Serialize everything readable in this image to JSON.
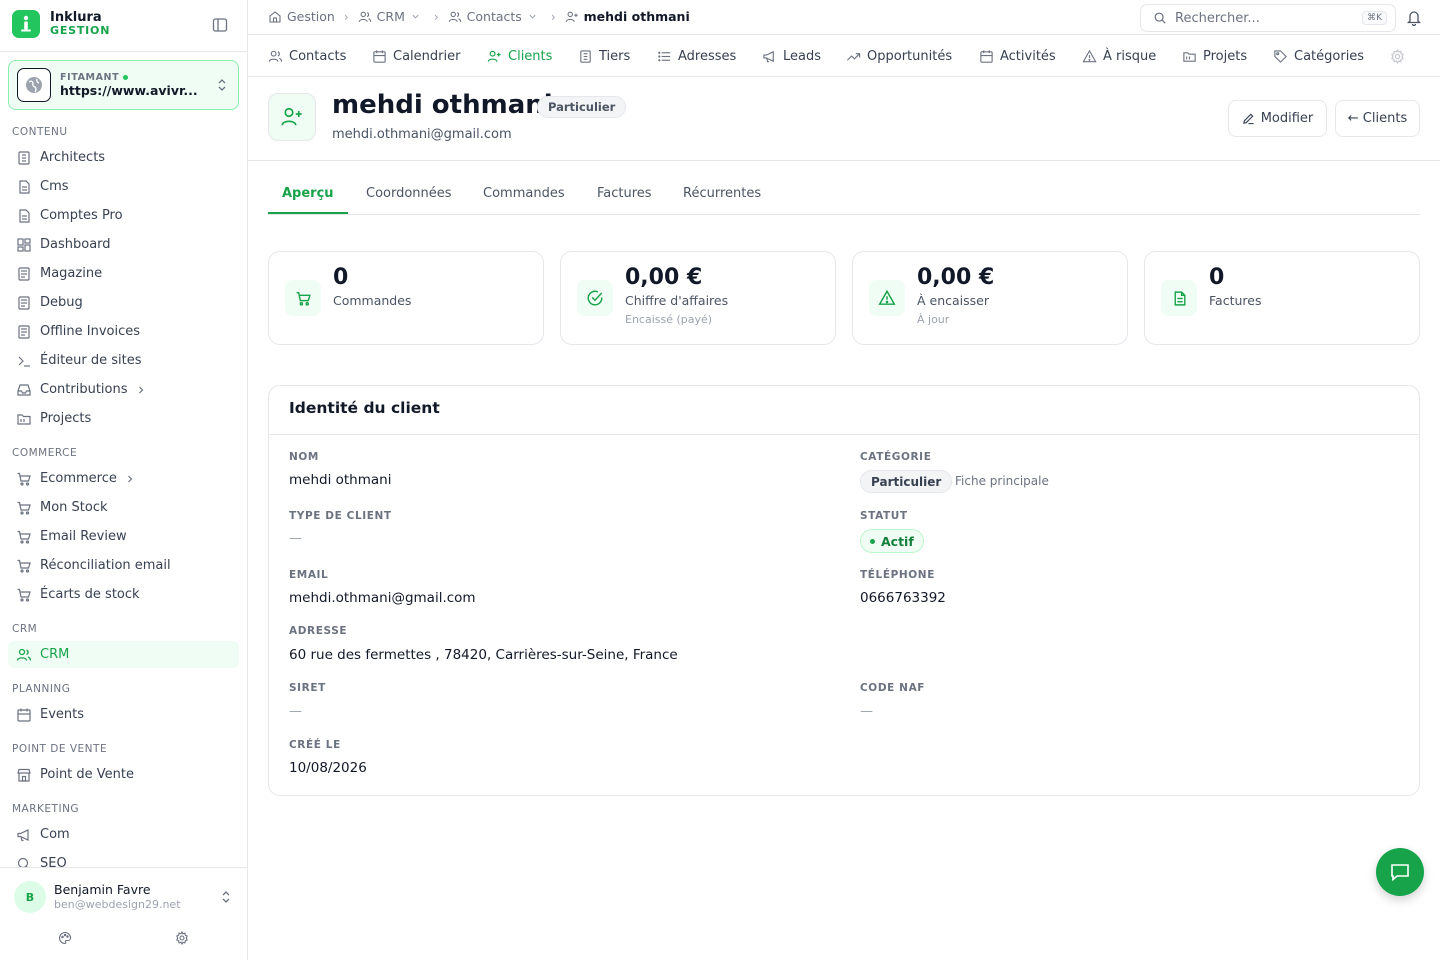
{
  "brand": {
    "name": "Inklura",
    "subtitle": "GESTION"
  },
  "site_selector": {
    "label": "FITAMANT",
    "url": "https://www.avivr..."
  },
  "sidebar": {
    "sections": [
      {
        "title": "CONTENU",
        "items": [
          {
            "label": "Architects",
            "icon": "building-icon"
          },
          {
            "label": "Cms",
            "icon": "file-icon"
          },
          {
            "label": "Comptes Pro",
            "icon": "file-icon"
          },
          {
            "label": "Dashboard",
            "icon": "grid-icon"
          },
          {
            "label": "Magazine",
            "icon": "newspaper-icon"
          },
          {
            "label": "Debug",
            "icon": "newspaper-icon"
          },
          {
            "label": "Offline Invoices",
            "icon": "newspaper-icon"
          },
          {
            "label": "Éditeur de sites",
            "icon": "terminal-icon"
          },
          {
            "label": "Contributions",
            "icon": "inbox-icon",
            "has_children": true
          },
          {
            "label": "Projects",
            "icon": "folder-icon"
          }
        ]
      },
      {
        "title": "COMMERCE",
        "items": [
          {
            "label": "Ecommerce",
            "icon": "cart-icon",
            "has_children": true
          },
          {
            "label": "Mon Stock",
            "icon": "cart-icon"
          },
          {
            "label": "Email Review",
            "icon": "cart-icon"
          },
          {
            "label": "Réconciliation email",
            "icon": "cart-icon"
          },
          {
            "label": "Écarts de stock",
            "icon": "cart-icon"
          }
        ]
      },
      {
        "title": "CRM",
        "items": [
          {
            "label": "CRM",
            "icon": "users-icon",
            "active": true
          }
        ]
      },
      {
        "title": "PLANNING",
        "items": [
          {
            "label": "Events",
            "icon": "calendar-icon"
          }
        ]
      },
      {
        "title": "POINT DE VENTE",
        "items": [
          {
            "label": "Point de Vente",
            "icon": "store-icon"
          }
        ]
      },
      {
        "title": "MARKETING",
        "items": [
          {
            "label": "Com",
            "icon": "megaphone-icon"
          },
          {
            "label": "SEO",
            "icon": "search-icon"
          }
        ]
      }
    ]
  },
  "user": {
    "initial": "B",
    "name": "Benjamin Favre",
    "email": "ben@webdesign29.net"
  },
  "breadcrumb": [
    {
      "label": "Gestion",
      "icon": "home-icon"
    },
    {
      "label": "CRM",
      "icon": "users-icon",
      "dropdown": true
    },
    {
      "label": "Contacts",
      "icon": "users-icon",
      "dropdown": true
    },
    {
      "label": "mehdi othmani",
      "icon": "user-plus-icon",
      "current": true
    }
  ],
  "search": {
    "placeholder": "Rechercher...",
    "shortcut": "⌘K"
  },
  "module_tabs": [
    {
      "label": "Contacts",
      "icon": "users-icon"
    },
    {
      "label": "Calendrier",
      "icon": "calendar-icon"
    },
    {
      "label": "Clients",
      "icon": "user-plus-icon",
      "active": true
    },
    {
      "label": "Tiers",
      "icon": "building-icon"
    },
    {
      "label": "Adresses",
      "icon": "list-icon"
    },
    {
      "label": "Leads",
      "icon": "megaphone-icon"
    },
    {
      "label": "Opportunités",
      "icon": "trending-icon"
    },
    {
      "label": "Activités",
      "icon": "calendar-icon"
    },
    {
      "label": "À risque",
      "icon": "alert-icon"
    },
    {
      "label": "Projets",
      "icon": "folder-icon"
    },
    {
      "label": "Catégories",
      "icon": "tag-icon"
    }
  ],
  "client": {
    "name": "mehdi othmani",
    "badge": "Particulier",
    "email": "mehdi.othmani@gmail.com"
  },
  "header_actions": {
    "edit": "Modifier",
    "back": "← Clients"
  },
  "content_tabs": [
    "Aperçu",
    "Coordonnées",
    "Commandes",
    "Factures",
    "Récurrentes"
  ],
  "stats": [
    {
      "value": "0",
      "label": "Commandes",
      "sub": "",
      "icon": "cart-icon"
    },
    {
      "value": "0,00 €",
      "label": "Chiffre d'affaires",
      "sub": "Encaissé (payé)",
      "icon": "check-circle-icon"
    },
    {
      "value": "0,00 €",
      "label": "À encaisser",
      "sub": "À jour",
      "icon": "alert-icon"
    },
    {
      "value": "0",
      "label": "Factures",
      "sub": "",
      "icon": "document-icon"
    }
  ],
  "identity": {
    "title": "Identité du client",
    "nom_label": "NOM",
    "nom": "mehdi othmani",
    "categorie_label": "CATÉGORIE",
    "categorie": "Particulier",
    "categorie_note": "Fiche principale",
    "type_label": "TYPE DE CLIENT",
    "type": "—",
    "statut_label": "STATUT",
    "statut": "Actif",
    "email_label": "EMAIL",
    "email": "mehdi.othmani@gmail.com",
    "telephone_label": "TÉLÉPHONE",
    "telephone": "0666763392",
    "adresse_label": "ADRESSE",
    "adresse": "60 rue des fermettes , 78420, Carrières-sur-Seine, France",
    "siret_label": "SIRET",
    "siret": "—",
    "naf_label": "CODE NAF",
    "naf": "—",
    "cree_label": "CRÉÉ LE",
    "cree": "10/08/2026"
  },
  "colors": {
    "accent": "#16a34a",
    "accent_light": "#f0fdf4",
    "border": "#e5e7eb"
  }
}
